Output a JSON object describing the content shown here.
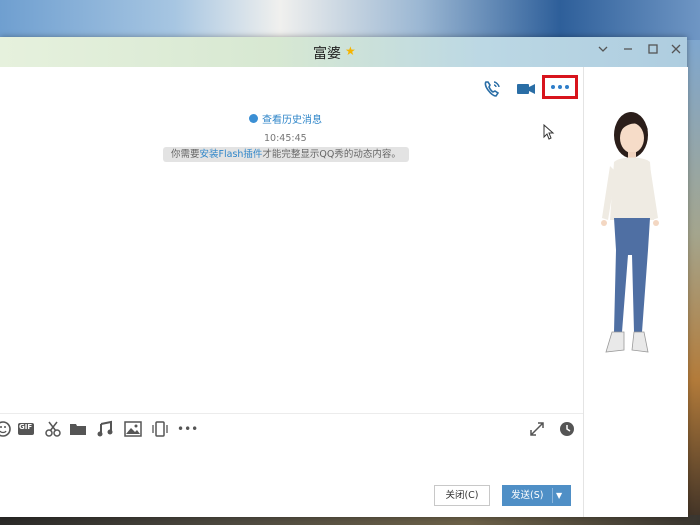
{
  "window": {
    "title": "富婆"
  },
  "chat": {
    "history_link": "查看历史消息",
    "timestamp": "10:45:45",
    "notice_prefix": "你需要",
    "notice_link": "安装Flash插件",
    "notice_suffix": "才能完整显示QQ秀的动态内容。"
  },
  "toolbar": {
    "gif_label": "GIF",
    "more_label": "•••"
  },
  "buttons": {
    "close_label": "关闭(C)",
    "send_label": "发送(S)"
  },
  "colors": {
    "accent": "#2f86c9",
    "highlight_box": "#d8141c",
    "send_button": "#4f8fc6"
  },
  "icons": {
    "header": [
      "phone-icon",
      "video-icon",
      "more-icon"
    ],
    "toolbar": [
      "emoji-icon",
      "gif-icon",
      "scissors-icon",
      "folder-icon",
      "music-icon",
      "image-icon",
      "shake-icon",
      "more-icon",
      "expand-icon",
      "history-clock-icon"
    ]
  }
}
